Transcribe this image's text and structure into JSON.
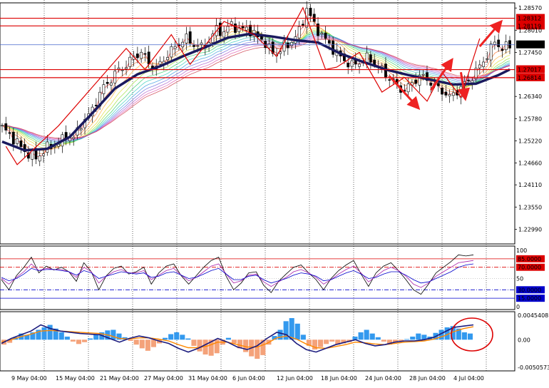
{
  "chart_data": [
    {
      "panel": "price",
      "type": "candlestick",
      "title": "",
      "y_ticks": [
        "1.28570",
        "1.28010",
        "1.27450",
        "1.26340",
        "1.25780",
        "1.25220",
        "1.24660",
        "1.24110",
        "1.23550",
        "1.22990"
      ],
      "ylim": [
        1.2262,
        1.287
      ],
      "x_ticks": [
        "9 May 04:00",
        "15 May 04:00",
        "21 May 04:00",
        "27 May 04:00",
        "31 May 04:00",
        "6 Jun 04:00",
        "12 Jun 04:00",
        "18 Jun 04:00",
        "24 Jun 04:00",
        "28 Jun 04:00",
        "4 Jul 04:00"
      ],
      "close_path": [
        [
          0,
          1.2555
        ],
        [
          3,
          1.2528
        ],
        [
          6,
          1.2495
        ],
        [
          9,
          1.2478
        ],
        [
          12,
          1.2505
        ],
        [
          15,
          1.2515
        ],
        [
          17,
          1.2535
        ],
        [
          19,
          1.2528
        ],
        [
          21,
          1.2565
        ],
        [
          23,
          1.2585
        ],
        [
          25,
          1.2622
        ],
        [
          27,
          1.2658
        ],
        [
          29,
          1.2678
        ],
        [
          31,
          1.2702
        ],
        [
          33,
          1.2712
        ],
        [
          35,
          1.2735
        ],
        [
          37,
          1.2745
        ],
        [
          39,
          1.2718
        ],
        [
          41,
          1.2705
        ],
        [
          43,
          1.2728
        ],
        [
          45,
          1.275
        ],
        [
          47,
          1.2768
        ],
        [
          49,
          1.278
        ],
        [
          51,
          1.2765
        ],
        [
          53,
          1.2758
        ],
        [
          55,
          1.2772
        ],
        [
          57,
          1.2805
        ],
        [
          59,
          1.2795
        ],
        [
          61,
          1.2818
        ],
        [
          63,
          1.28
        ],
        [
          65,
          1.2808
        ],
        [
          67,
          1.2789
        ],
        [
          69,
          1.278
        ],
        [
          71,
          1.2752
        ],
        [
          73,
          1.2742
        ],
        [
          75,
          1.276
        ],
        [
          77,
          1.2772
        ],
        [
          79,
          1.2798
        ],
        [
          81,
          1.2855
        ],
        [
          83,
          1.2815
        ],
        [
          85,
          1.2788
        ],
        [
          87,
          1.2765
        ],
        [
          89,
          1.2742
        ],
        [
          91,
          1.2725
        ],
        [
          93,
          1.2712
        ],
        [
          95,
          1.272
        ],
        [
          97,
          1.2731
        ],
        [
          99,
          1.2718
        ],
        [
          101,
          1.27
        ],
        [
          103,
          1.268
        ],
        [
          105,
          1.266
        ],
        [
          107,
          1.2648
        ],
        [
          109,
          1.2668
        ],
        [
          111,
          1.2685
        ],
        [
          113,
          1.2678
        ],
        [
          115,
          1.266
        ],
        [
          117,
          1.2648
        ],
        [
          119,
          1.2632
        ],
        [
          121,
          1.2648
        ],
        [
          123,
          1.2665
        ],
        [
          125,
          1.2685
        ],
        [
          127,
          1.271
        ],
        [
          129,
          1.2738
        ],
        [
          131,
          1.2772
        ],
        [
          133,
          1.2755
        ],
        [
          135,
          1.2762
        ]
      ],
      "ma_thick": [
        [
          0,
          1.252
        ],
        [
          6,
          1.2498
        ],
        [
          12,
          1.2502
        ],
        [
          18,
          1.2532
        ],
        [
          24,
          1.2592
        ],
        [
          30,
          1.2654
        ],
        [
          36,
          1.269
        ],
        [
          42,
          1.271
        ],
        [
          48,
          1.2735
        ],
        [
          54,
          1.2758
        ],
        [
          60,
          1.2782
        ],
        [
          66,
          1.2792
        ],
        [
          72,
          1.2785
        ],
        [
          78,
          1.2776
        ],
        [
          84,
          1.277
        ],
        [
          90,
          1.2742
        ],
        [
          96,
          1.2721
        ],
        [
          102,
          1.2702
        ],
        [
          108,
          1.2688
        ],
        [
          114,
          1.2676
        ],
        [
          120,
          1.2664
        ],
        [
          126,
          1.2666
        ],
        [
          132,
          1.2688
        ],
        [
          135,
          1.2702
        ]
      ],
      "zigzag": [
        [
          1,
          1.2508
        ],
        [
          4,
          1.2462
        ],
        [
          15,
          1.256
        ],
        [
          33,
          1.2755
        ],
        [
          38,
          1.2702
        ],
        [
          45,
          1.279
        ],
        [
          50,
          1.2715
        ],
        [
          59,
          1.2823
        ],
        [
          67,
          1.279
        ],
        [
          73,
          1.2735
        ],
        [
          80,
          1.2858
        ],
        [
          86,
          1.2702
        ],
        [
          89,
          1.2708
        ],
        [
          95,
          1.2745
        ],
        [
          101,
          1.2645
        ],
        [
          107,
          1.2682
        ],
        [
          113,
          1.2622
        ],
        [
          117,
          1.2695
        ],
        [
          122,
          1.2632
        ],
        [
          127,
          1.278
        ]
      ],
      "arrows": [
        {
          "from": [
            103,
            1.2685
          ],
          "to": [
            110,
            1.2612
          ]
        },
        {
          "from": [
            114,
            1.265
          ],
          "to": [
            119,
            1.2718
          ]
        },
        {
          "from": [
            122,
            1.2695
          ],
          "to": [
            123,
            1.2638
          ]
        },
        {
          "from": [
            127,
            1.276
          ],
          "to": [
            132,
            1.2815
          ]
        }
      ],
      "h_lines": [
        {
          "value": 1.28312,
          "label": "1.28312",
          "color": "#dd0000",
          "boxed": true
        },
        {
          "value": 1.28119,
          "label": "1.28119",
          "color": "#dd0000",
          "boxed": true
        },
        {
          "value": 1.27643,
          "label": "1.27643",
          "color": "#4466cc",
          "boxed": true,
          "box_color": "#000000"
        },
        {
          "value": 1.27017,
          "label": "1.27017",
          "color": "#dd0000",
          "boxed": true
        },
        {
          "value": 1.26814,
          "label": "1.26814",
          "color": "#dd0000",
          "boxed": true
        }
      ],
      "current_price": "1.27643"
    },
    {
      "panel": "oscillator",
      "type": "line",
      "title": "",
      "ylim": [
        0,
        100
      ],
      "y_ticks": [
        "100",
        "50",
        "0"
      ],
      "levels": [
        {
          "value": 85,
          "label": "85.0000",
          "color": "#dd0000",
          "style": "solid"
        },
        {
          "value": 70,
          "label": "70.0000",
          "color": "#dd0000",
          "style": "dashdot"
        },
        {
          "value": 30,
          "label": "30.0000",
          "color": "#0000cc",
          "style": "dashdot"
        },
        {
          "value": 15,
          "label": "15.0000",
          "color": "#0000cc",
          "style": "solid"
        }
      ],
      "series": [
        {
          "color": "#000000",
          "values": [
            48,
            30,
            55,
            70,
            88,
            60,
            72,
            65,
            70,
            62,
            45,
            78,
            62,
            30,
            55,
            68,
            72,
            58,
            62,
            70,
            40,
            60,
            72,
            76,
            55,
            40,
            55,
            70,
            82,
            88,
            54,
            30,
            42,
            60,
            62,
            38,
            25,
            45,
            58,
            70,
            74,
            60,
            48,
            30,
            50,
            64,
            74,
            82,
            58,
            36,
            60,
            72,
            78,
            64,
            48,
            30,
            22,
            40,
            60,
            70,
            80,
            92,
            90,
            92
          ]
        },
        {
          "color": "#aa22aa",
          "values": [
            50,
            40,
            52,
            62,
            76,
            64,
            68,
            66,
            66,
            62,
            52,
            70,
            62,
            42,
            54,
            62,
            66,
            60,
            60,
            64,
            48,
            56,
            64,
            68,
            56,
            46,
            52,
            62,
            72,
            76,
            58,
            42,
            46,
            56,
            58,
            44,
            36,
            44,
            52,
            62,
            66,
            60,
            52,
            40,
            48,
            58,
            66,
            72,
            60,
            44,
            54,
            64,
            70,
            64,
            54,
            40,
            34,
            42,
            54,
            62,
            70,
            78,
            80,
            82
          ]
        },
        {
          "color": "#0000cc",
          "values": [
            52,
            46,
            50,
            58,
            68,
            64,
            66,
            66,
            64,
            62,
            56,
            64,
            60,
            50,
            54,
            58,
            62,
            60,
            58,
            60,
            52,
            54,
            60,
            62,
            56,
            50,
            52,
            58,
            64,
            68,
            58,
            48,
            48,
            54,
            56,
            48,
            42,
            46,
            50,
            56,
            60,
            58,
            54,
            46,
            48,
            54,
            60,
            64,
            58,
            50,
            52,
            58,
            62,
            62,
            56,
            48,
            42,
            44,
            50,
            56,
            62,
            70,
            74,
            76
          ]
        }
      ]
    },
    {
      "panel": "macd",
      "type": "bar",
      "title": "",
      "y_ticks": [
        "0.0045408",
        "0.00",
        "-0.0050573"
      ],
      "ylim": [
        -0.0050573,
        0.0045408
      ],
      "histogram": [
        -0.0008,
        -0.0005,
        0.0004,
        0.001,
        0.0008,
        0.0012,
        0.0016,
        0.002,
        0.0024,
        0.0018,
        0.0012,
        0.0005,
        -0.0003,
        -0.0007,
        -0.0004,
        0.0002,
        0.0008,
        0.0012,
        0.0015,
        0.0016,
        0.001,
        0.0004,
        -0.0002,
        -0.0008,
        -0.0014,
        -0.0018,
        -0.0012,
        -0.0006,
        0.0003,
        0.0009,
        0.0012,
        0.0008,
        0.0002,
        -0.001,
        -0.0019,
        -0.0024,
        -0.0026,
        -0.0022,
        -0.0008,
        0.0003,
        -0.0006,
        -0.0014,
        -0.002,
        -0.0027,
        -0.0031,
        -0.0025,
        -0.0008,
        0.0006,
        0.0016,
        0.003,
        0.0035,
        0.0026,
        0.0008,
        -0.001,
        -0.0016,
        -0.0012,
        -0.0007,
        -0.0003,
        -0.0008,
        -0.0006,
        -0.0004,
        0.0005,
        0.0012,
        0.0016,
        0.001,
        0.0004,
        -0.0003,
        -0.0008,
        -0.0004,
        -0.0002,
        0.0001,
        0.0005,
        0.001,
        0.0008,
        0.0005,
        0.0011,
        0.0016,
        0.002,
        0.0022,
        0.0018,
        0.0012,
        0.001
      ],
      "macd_line": [
        -0.0006,
        0.0002,
        0.0008,
        0.0014,
        0.0024,
        0.0018,
        0.0014,
        0.0012,
        0.001,
        0.0009,
        0.0008,
        0.0002,
        -0.0004,
        0.0002,
        0.0006,
        0.0003,
        -0.0002,
        -0.0006,
        -0.0014,
        -0.002,
        -0.0014,
        -0.0006,
        0.0002,
        -0.0004,
        -0.0012,
        -0.0016,
        -0.001,
        0.0002,
        0.0012,
        0.0008,
        -0.0006,
        -0.0016,
        -0.002,
        -0.0014,
        -0.0008,
        -0.0004,
        0.0,
        -0.0006,
        -0.001,
        -0.0008,
        -0.0004,
        -0.0002,
        -0.0002,
        0.0,
        0.0004,
        0.0012,
        0.002,
        0.0022,
        0.0024
      ],
      "signal_line": [
        -0.0004,
        0.0,
        0.0005,
        0.0009,
        0.0014,
        0.0015,
        0.0014,
        0.0013,
        0.0012,
        0.0011,
        0.001,
        0.0007,
        0.0002,
        0.0001,
        0.0003,
        0.0003,
        0.0001,
        -0.0002,
        -0.0008,
        -0.0013,
        -0.0013,
        -0.001,
        -0.0004,
        -0.0004,
        -0.0008,
        -0.0012,
        -0.0012,
        -0.0006,
        0.0003,
        0.0006,
        0.0001,
        -0.0007,
        -0.0013,
        -0.0014,
        -0.0011,
        -0.0008,
        -0.0004,
        -0.0005,
        -0.0007,
        -0.0008,
        -0.0006,
        -0.0004,
        -0.0003,
        -0.0002,
        0.0001,
        0.0006,
        0.0013,
        0.0018,
        0.0021
      ]
    }
  ]
}
